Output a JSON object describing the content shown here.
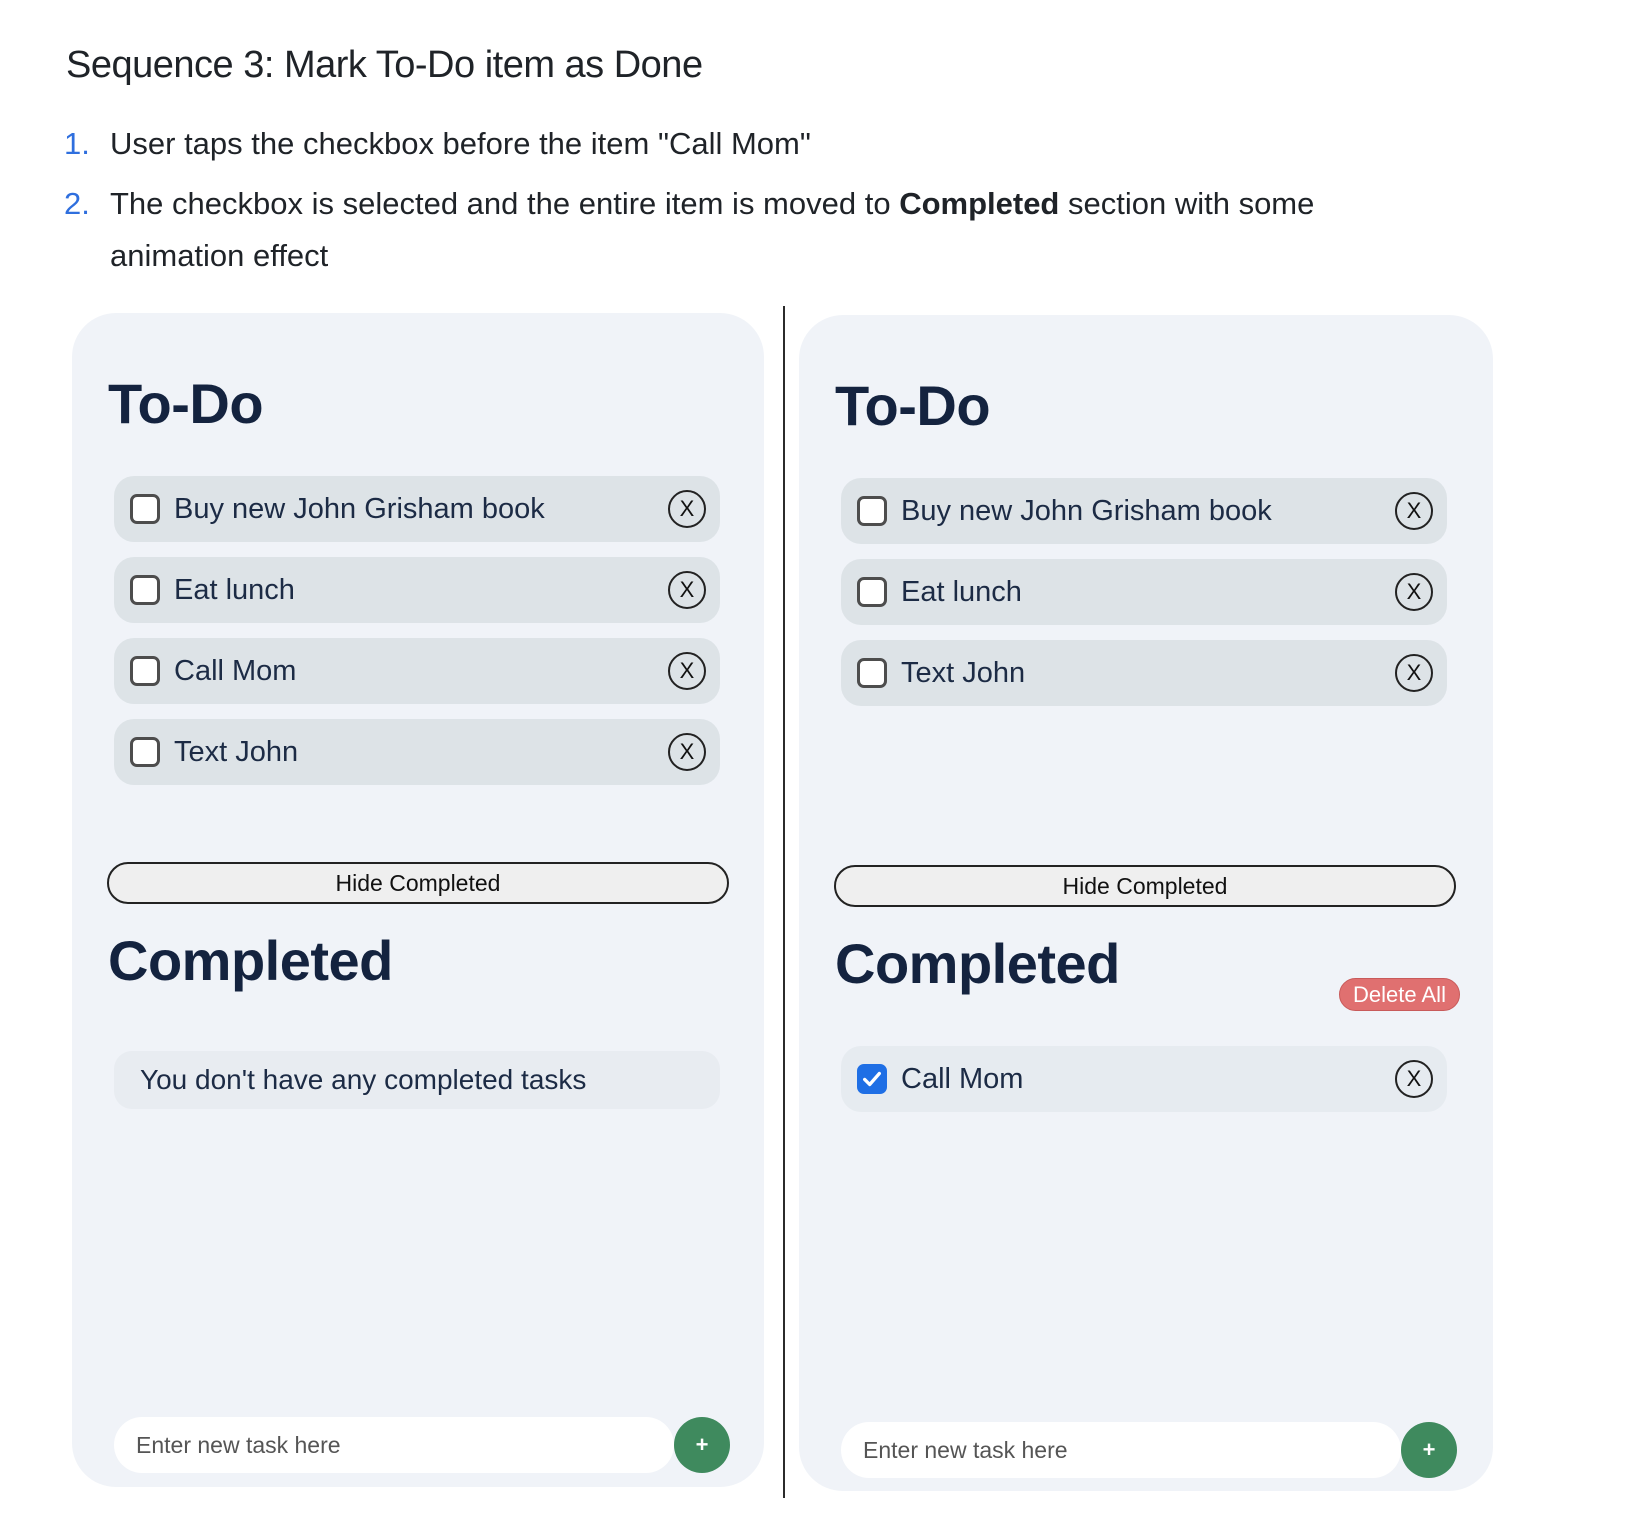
{
  "doc": {
    "title": "Sequence 3: Mark To-Do item as Done",
    "steps": [
      {
        "num": "1.",
        "text": "User taps the checkbox before the item \"Call Mom\""
      },
      {
        "num": "2.",
        "text_before": "The checkbox is selected and the entire item is moved to ",
        "text_bold": "Completed",
        "text_after": " section with some animation effect"
      }
    ]
  },
  "left_panel": {
    "todo_title": "To-Do",
    "todo_items": [
      {
        "label": "Buy new John Grisham book",
        "checked": false
      },
      {
        "label": "Eat lunch",
        "checked": false
      },
      {
        "label": "Call Mom",
        "checked": false
      },
      {
        "label": "Text John",
        "checked": false
      }
    ],
    "hide_completed_label": "Hide Completed",
    "completed_title": "Completed",
    "empty_message": "You don't have any completed tasks",
    "new_task_placeholder": "Enter new task here",
    "add_label": "+",
    "delete_label": "X"
  },
  "right_panel": {
    "todo_title": "To-Do",
    "todo_items": [
      {
        "label": "Buy new John Grisham book",
        "checked": false
      },
      {
        "label": "Eat lunch",
        "checked": false
      },
      {
        "label": "Text John",
        "checked": false
      }
    ],
    "hide_completed_label": "Hide Completed",
    "completed_title": "Completed",
    "delete_all_label": "Delete All",
    "completed_items": [
      {
        "label": "Call Mom",
        "checked": true
      }
    ],
    "new_task_placeholder": "Enter new task here",
    "add_label": "+",
    "delete_label": "X"
  },
  "colors": {
    "panel_bg": "#f0f3f8",
    "item_bg": "#dde3e7",
    "title_color": "#14233f",
    "checkbox_checked": "#1f6fe5",
    "delete_all_bg": "#e07070",
    "add_button_bg": "#3f8a5e",
    "step_number": "#2f6fde"
  }
}
